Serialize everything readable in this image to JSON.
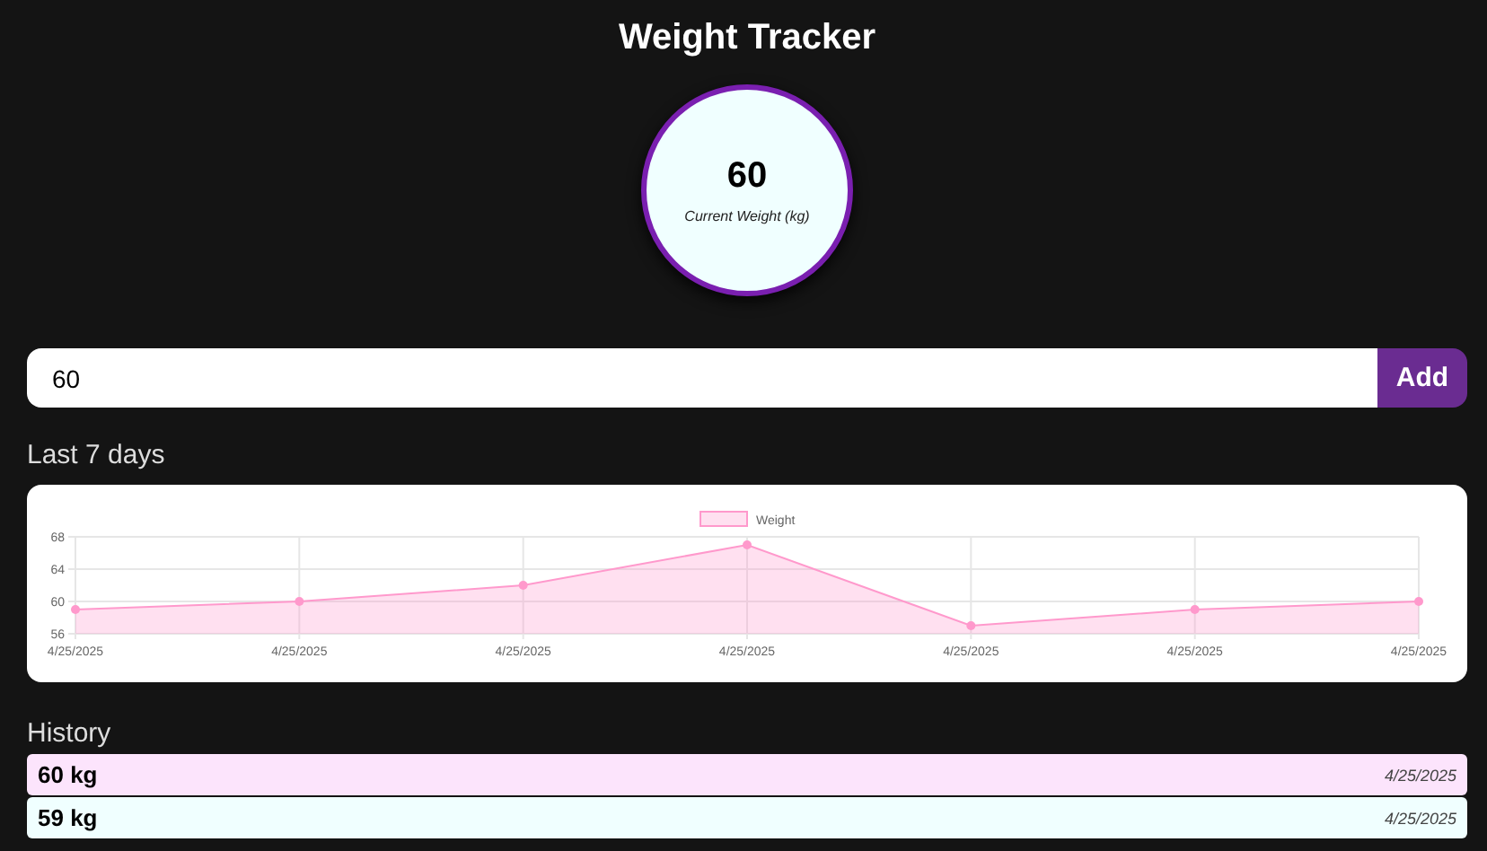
{
  "title": "Weight Tracker",
  "current": {
    "value": "60",
    "label": "Current Weight (kg)"
  },
  "entry": {
    "value": "60",
    "button": "Add"
  },
  "recent": {
    "heading": "Last 7 days",
    "chart_data": {
      "type": "area",
      "categories": [
        "4/25/2025",
        "4/25/2025",
        "4/25/2025",
        "4/25/2025",
        "4/25/2025",
        "4/25/2025",
        "4/25/2025"
      ],
      "series": [
        {
          "name": "Weight",
          "color": "#ff99cc",
          "values": [
            59,
            60,
            62,
            67,
            57,
            59,
            60
          ]
        }
      ],
      "ylim": [
        56,
        68
      ],
      "yticks": [
        {
          "value": 56,
          "label": "56"
        },
        {
          "value": 60,
          "label": "60"
        },
        {
          "value": 64,
          "label": "64"
        },
        {
          "value": 68,
          "label": "68"
        }
      ],
      "grid": true
    }
  },
  "history": {
    "heading": "History",
    "entries": [
      {
        "weight": "60 kg",
        "date": "4/25/2025",
        "color": "#fce4fc"
      },
      {
        "weight": "59 kg",
        "date": "4/25/2025",
        "color": "#f0ffff"
      }
    ]
  }
}
